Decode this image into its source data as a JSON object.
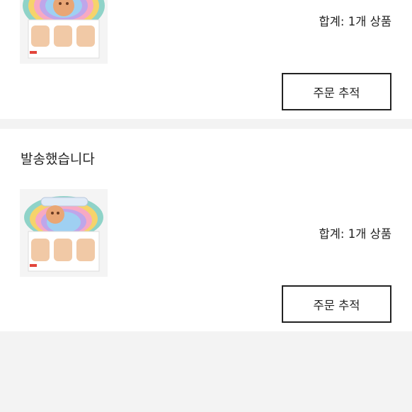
{
  "orders": [
    {
      "status": "",
      "product_image": "blind-box-figure-set",
      "total_text": "합계: 1개 상품",
      "track_button": "주문 추적"
    },
    {
      "status": "발송했습니다",
      "product_image": "blind-box-figure-set",
      "total_text": "합계: 1개 상품",
      "track_button": "주문 추적"
    }
  ],
  "colors": {
    "page_background": "#f3f3f3",
    "card_background": "#ffffff",
    "text": "#222222",
    "button_border": "#222222"
  }
}
